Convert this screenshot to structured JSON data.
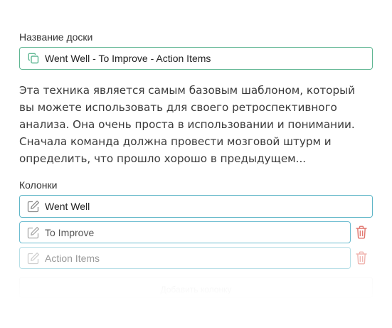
{
  "board": {
    "label": "Название доски",
    "value": "Went Well - To Improve - Action Items",
    "icon": "copy-icon"
  },
  "description": "Эта техника является самым базовым шаблоном, который вы можете использовать для своего ретроспективного анализа. Она очень проста в использовании и понимании. Сначала команда должна провести мозговой штурм и определить, что прошло хорошо в предыдущем...",
  "columns": {
    "label": "Колонки",
    "items": [
      {
        "value": "Went Well",
        "icon": "edit-icon",
        "deletable": false
      },
      {
        "value": "To Improve",
        "icon": "edit-icon",
        "deletable": true
      },
      {
        "value": "Action Items",
        "icon": "edit-icon",
        "deletable": true
      }
    ],
    "add_label": "Добавить колонку"
  },
  "colors": {
    "accent_green": "#5fb692",
    "accent_blue": "#5fb6c7",
    "delete_red": "#e0736b"
  }
}
